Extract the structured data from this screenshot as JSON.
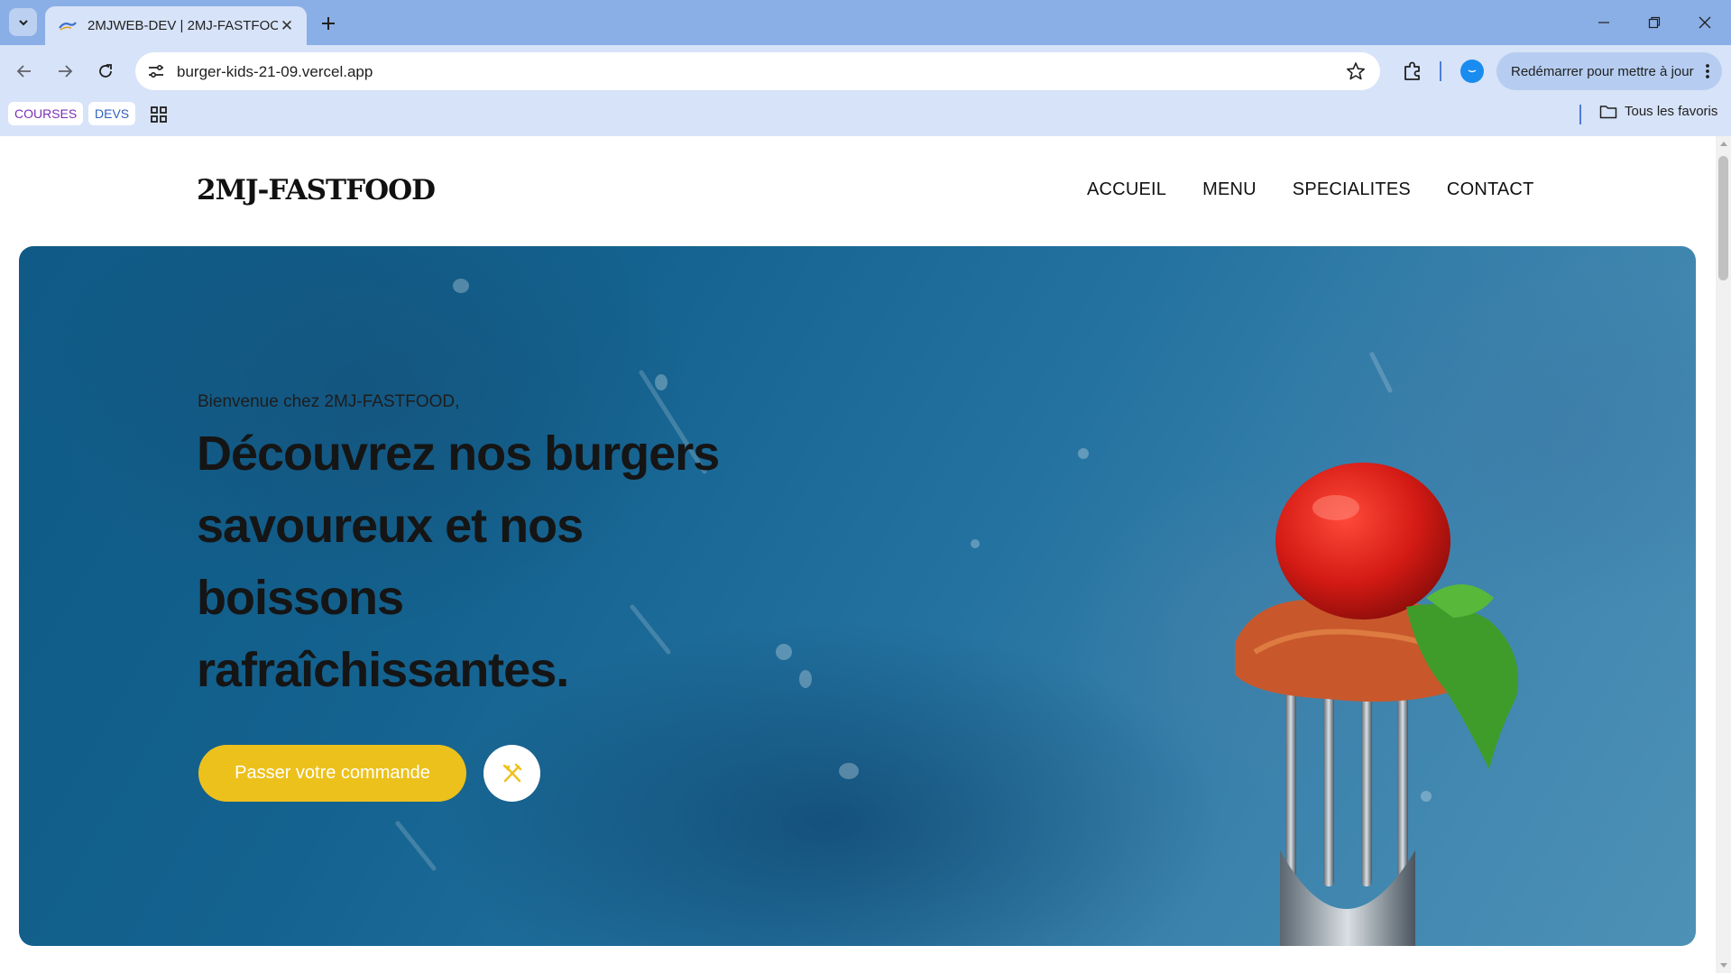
{
  "browser": {
    "tab_title": "2MJWEB-DEV | 2MJ-FASTFOOD",
    "url": "burger-kids-21-09.vercel.app",
    "update_button": "Redémarrer pour mettre à jour",
    "bookmarks": [
      "COURSES",
      "DEVS"
    ],
    "all_bookmarks": "Tous les favoris",
    "icons": [
      "tab-search-icon",
      "close-icon",
      "plus-icon",
      "minimize-icon",
      "restore-icon",
      "close-window-icon",
      "back-icon",
      "forward-icon",
      "reload-icon",
      "site-settings-icon",
      "star-icon",
      "extensions-icon",
      "profile-icon",
      "more-icon",
      "apps-icon",
      "folder-icon"
    ]
  },
  "site": {
    "logo": "2MJ-FASTFOOD",
    "nav": [
      "ACCUEIL",
      "MENU",
      "SPECIALITES",
      "CONTACT"
    ],
    "hero": {
      "welcome": "Bienvenue chez 2MJ-FASTFOOD,",
      "title": "Découvrez nos burgers savoureux et nos boissons rafraîchissantes.",
      "order_button": "Passer votre commande",
      "cutlery_icon": "utensils-icon"
    },
    "colors": {
      "accent": "#edc11c",
      "hero_blue": "#14628f",
      "chrome_tabbar": "#8aaee6",
      "chrome_toolbar": "#d7e3f8"
    }
  }
}
